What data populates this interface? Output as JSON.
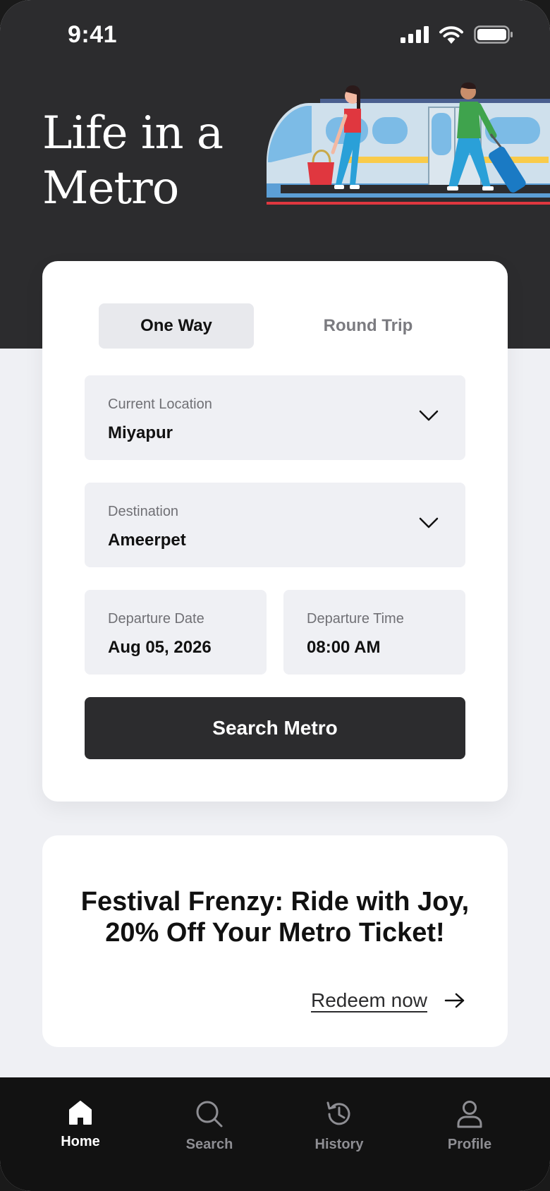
{
  "status_bar": {
    "time": "9:41"
  },
  "hero": {
    "title_line1": "Life in a",
    "title_line2": "Metro"
  },
  "trip_tabs": [
    {
      "label": "One Way",
      "selected": true
    },
    {
      "label": "Round Trip",
      "selected": false
    }
  ],
  "form": {
    "current_location": {
      "label": "Current Location",
      "value": "Miyapur"
    },
    "destination": {
      "label": "Destination",
      "value": "Ameerpet"
    },
    "departure_date": {
      "label": "Departure Date",
      "value": "Aug 05, 2026"
    },
    "departure_time": {
      "label": "Departure Time",
      "value": "08:00 AM"
    },
    "search_label": "Search Metro"
  },
  "promo": {
    "line1": "Festival Frenzy: Ride with Joy,",
    "line2": "20% Off Your Metro Ticket!",
    "cta": "Redeem now"
  },
  "nav": [
    {
      "label": "Home",
      "icon": "home-icon",
      "active": true
    },
    {
      "label": "Search",
      "icon": "search-icon",
      "active": false
    },
    {
      "label": "History",
      "icon": "history-icon",
      "active": false
    },
    {
      "label": "Profile",
      "icon": "profile-icon",
      "active": false
    }
  ],
  "colors": {
    "dark": "#2c2c2e",
    "nav_bg": "#121212",
    "page_bg": "#eff0f4",
    "field_bg": "#eff0f4",
    "accent_red": "#e0373f",
    "accent_yellow": "#f9cb4a"
  }
}
